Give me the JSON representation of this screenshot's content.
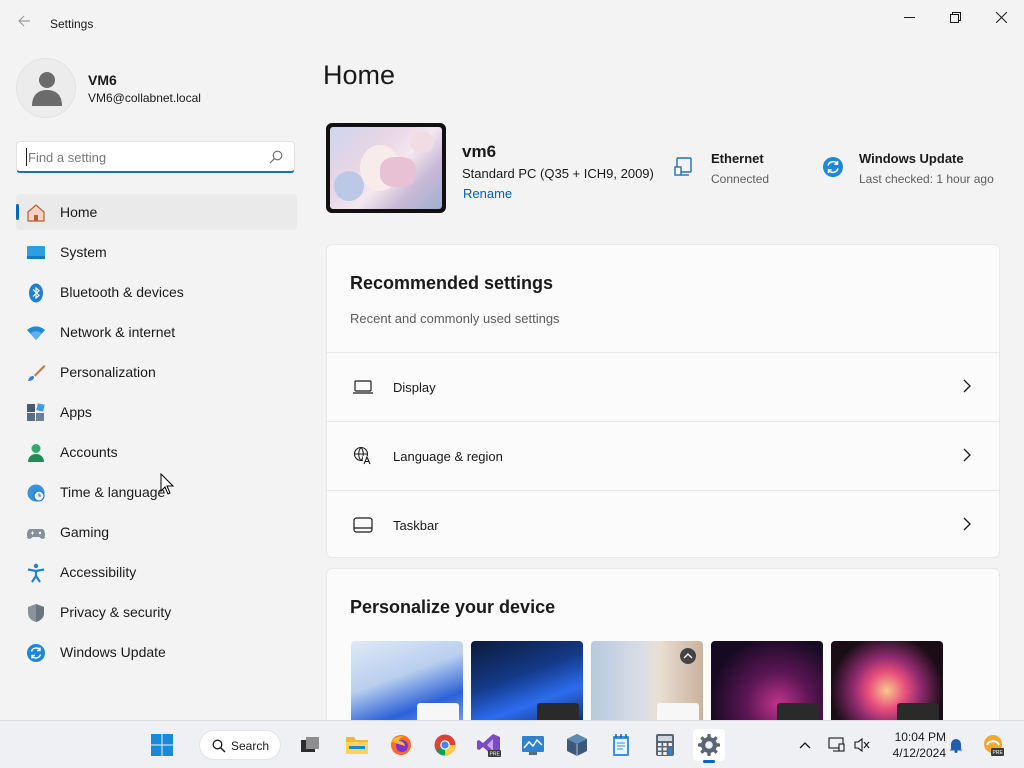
{
  "window": {
    "title": "Settings"
  },
  "profile": {
    "name": "VM6",
    "email": "VM6@collabnet.local"
  },
  "search": {
    "placeholder": "Find a setting"
  },
  "nav": {
    "items": [
      {
        "label": "Home",
        "icon": "home-icon",
        "active": true
      },
      {
        "label": "System",
        "icon": "system-icon"
      },
      {
        "label": "Bluetooth & devices",
        "icon": "bluetooth-icon"
      },
      {
        "label": "Network & internet",
        "icon": "wifi-icon"
      },
      {
        "label": "Personalization",
        "icon": "brush-icon"
      },
      {
        "label": "Apps",
        "icon": "apps-icon"
      },
      {
        "label": "Accounts",
        "icon": "accounts-icon"
      },
      {
        "label": "Time & language",
        "icon": "globe-clock-icon"
      },
      {
        "label": "Gaming",
        "icon": "gamepad-icon"
      },
      {
        "label": "Accessibility",
        "icon": "accessibility-icon"
      },
      {
        "label": "Privacy & security",
        "icon": "shield-icon"
      },
      {
        "label": "Windows Update",
        "icon": "update-icon"
      }
    ]
  },
  "main": {
    "title": "Home",
    "device": {
      "name": "vm6",
      "model": "Standard PC (Q35 + ICH9, 2009)",
      "rename_label": "Rename"
    },
    "status": [
      {
        "title": "Ethernet",
        "subtitle": "Connected",
        "icon": "ethernet-icon"
      },
      {
        "title": "Windows Update",
        "subtitle": "Last checked: 1 hour ago",
        "icon": "update-icon"
      }
    ],
    "recommended": {
      "title": "Recommended settings",
      "subtitle": "Recent and commonly used settings",
      "items": [
        {
          "label": "Display",
          "icon": "display-icon"
        },
        {
          "label": "Language & region",
          "icon": "language-icon"
        },
        {
          "label": "Taskbar",
          "icon": "taskbar-icon"
        }
      ]
    },
    "personalize": {
      "title": "Personalize your device"
    }
  },
  "taskbar": {
    "search_label": "Search",
    "time": "10:04 PM",
    "date": "4/12/2024"
  },
  "colors": {
    "accent": "#0067c0",
    "link": "#005fb8",
    "background": "#f3f3f3",
    "card": "#fbfbfb"
  }
}
